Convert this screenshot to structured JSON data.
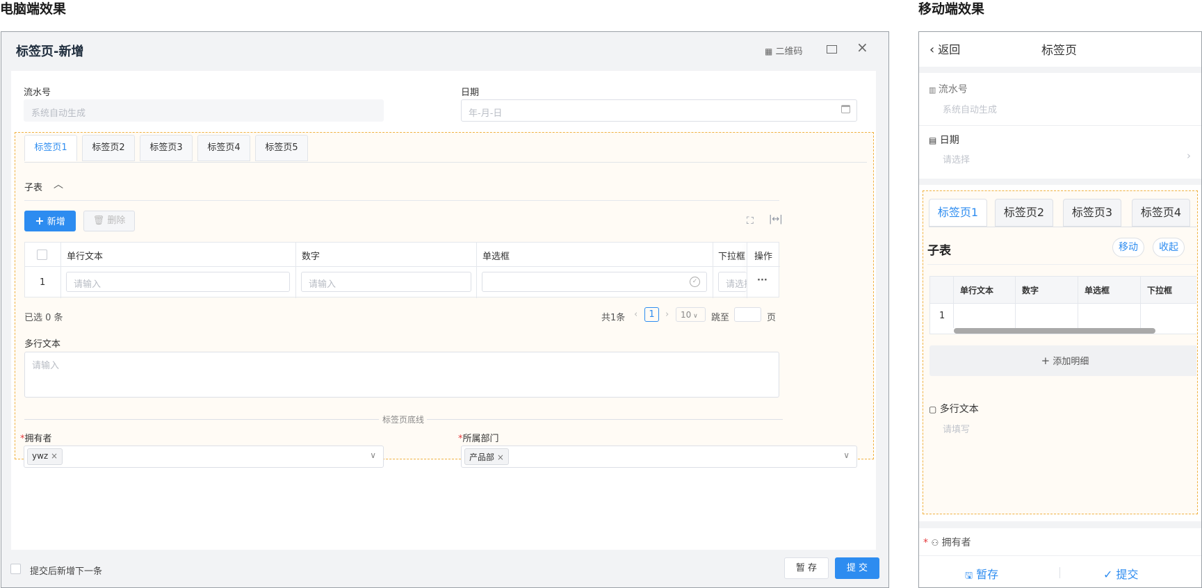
{
  "captions": {
    "pc": "电脑端效果",
    "mobile": "移动端效果"
  },
  "pc": {
    "title": "标签页-新增",
    "qr_label": "二维码",
    "fields": {
      "serial_label": "流水号",
      "serial_placeholder": "系统自动生成",
      "date_label": "日期",
      "date_placeholder": "年-月-日",
      "owner_label": "拥有者",
      "owner_tag": "ywz",
      "dept_label": "所属部门",
      "dept_tag": "产品部",
      "required_mark": "*"
    },
    "tabs": [
      "标签页1",
      "标签页2",
      "标签页3",
      "标签页4",
      "标签页5"
    ],
    "subtable": {
      "title": "子表",
      "add_label": "新增",
      "delete_label": "删除",
      "columns": [
        "单行文本",
        "数字",
        "单选框",
        "下拉框",
        "操作"
      ],
      "row_index": "1",
      "row_placeholder": "请输入",
      "select_placeholder": "请选择",
      "more": "···",
      "selected_text": "已选 0 条",
      "total_text": "共1条",
      "current_page": "1",
      "page_size": "10",
      "jump_label": "跳至",
      "page_suffix": "页"
    },
    "multiline": {
      "label": "多行文本",
      "placeholder": "请输入"
    },
    "divider_label": "标签页底线",
    "footer": {
      "continue_label": "提交后新增下一条",
      "save_label": "暂 存",
      "submit_label": "提 交"
    }
  },
  "mobile": {
    "back_label": "返回",
    "title": "标签页",
    "serial_label": "流水号",
    "serial_placeholder": "系统自动生成",
    "date_label": "日期",
    "date_placeholder": "请选择",
    "tabs": [
      "标签页1",
      "标签页2",
      "标签页3",
      "标签页4"
    ],
    "subtable_title": "子表",
    "move_label": "移动",
    "collapse_label": "收起",
    "columns": [
      "单行文本",
      "数字",
      "单选框",
      "下拉框"
    ],
    "row_index": "1",
    "add_detail_label": "添加明细",
    "multiline_label": "多行文本",
    "multiline_placeholder": "请填写",
    "owner_label": "拥有者",
    "required_mark": "*",
    "save_label": "暂存",
    "submit_label": "提交"
  },
  "colors": {
    "primary": "#2d8cf0",
    "dashed_border": "#f0b140",
    "tab_bg": "#fffbf5"
  }
}
